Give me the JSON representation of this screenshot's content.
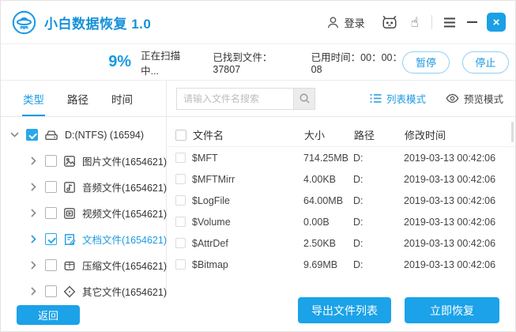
{
  "titlebar": {
    "app_title": "小白数据恢复 1.0",
    "login_label": "登录",
    "hand_glyph": "☝",
    "close_glyph": "×"
  },
  "progress": {
    "percent": "9%",
    "status": "正在扫描中...",
    "found": "已找到文件：37807",
    "elapsed": "已用时间：00：00：08",
    "pause_label": "暂停",
    "stop_label": "停止"
  },
  "filter": {
    "tabs": [
      {
        "label": "类型"
      },
      {
        "label": "路径"
      },
      {
        "label": "时间"
      }
    ],
    "search_placeholder": "请输入文件名搜索",
    "list_mode_label": "列表模式",
    "preview_mode_label": "预览模式"
  },
  "tree": {
    "root_label": "D:(NTFS) (16594)",
    "items": [
      {
        "label": "图片文件(1654621)"
      },
      {
        "label": "音频文件(1654621)"
      },
      {
        "label": "视频文件(1654621)"
      },
      {
        "label": "文档文件(1654621)"
      },
      {
        "label": "压缩文件(1654621)"
      },
      {
        "label": "其它文件(1654621)"
      }
    ]
  },
  "table": {
    "headers": {
      "name": "文件名",
      "size": "大小",
      "path": "路径",
      "modified": "修改时间"
    },
    "rows": [
      {
        "name": "$MFT",
        "size": "714.25MB",
        "path": "D:",
        "modified": "2019-03-13 00:42:06"
      },
      {
        "name": "$MFTMirr",
        "size": "4.00KB",
        "path": "D:",
        "modified": "2019-03-13 00:42:06"
      },
      {
        "name": "$LogFile",
        "size": "64.00MB",
        "path": "D:",
        "modified": "2019-03-13 00:42:06"
      },
      {
        "name": "$Volume",
        "size": "0.00B",
        "path": "D:",
        "modified": "2019-03-13 00:42:06"
      },
      {
        "name": "$AttrDef",
        "size": "2.50KB",
        "path": "D:",
        "modified": "2019-03-13 00:42:06"
      },
      {
        "name": "$Bitmap",
        "size": "9.69MB",
        "path": "D:",
        "modified": "2019-03-13 00:42:06"
      }
    ]
  },
  "footer": {
    "back_label": "返回",
    "export_label": "导出文件列表",
    "recover_label": "立即恢复"
  },
  "colors": {
    "primary_blue": "#1b9ae2",
    "progress_fill": "#ddf0fb",
    "button_blue": "#1ba2e8",
    "title_blue": "#1691da"
  },
  "icons": {
    "logo": "ufo-logo-icon",
    "titlebar": [
      "user-icon",
      "robot-icon",
      "hand-click-icon",
      "menu-icon",
      "minimize-icon",
      "close-icon"
    ],
    "search": "magnifier-icon",
    "modes": [
      "list-view-icon",
      "eye-preview-icon"
    ],
    "tree": [
      "drive-icon",
      "image-file-icon",
      "audio-file-icon",
      "video-file-icon",
      "document-file-icon",
      "archive-file-icon",
      "other-file-icon"
    ]
  }
}
